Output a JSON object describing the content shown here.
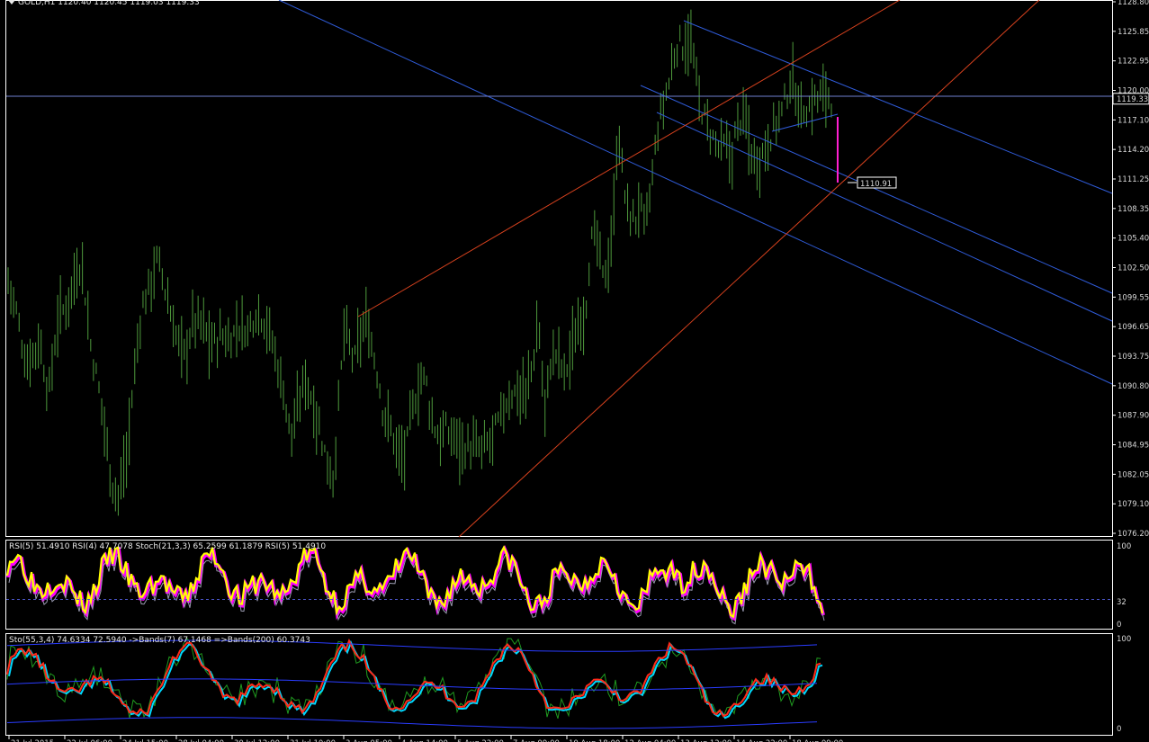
{
  "colors": {
    "background": "#000000",
    "frame": "#ffffff",
    "bar": "#4e9a3c",
    "channel_blue": "#2f5bd8",
    "channel_red": "#d9421e",
    "magenta": "#ff1fd0",
    "rsi_main": "#ffff00",
    "rsi_glow": "#ff00ff",
    "sto_red": "#ff2a1a",
    "sto_cyan": "#00d8ff",
    "sto_green": "#1f9a1f",
    "bands_blue": "#2a3cff"
  },
  "main": {
    "header": "GOLD,H1  1120.40 1120.45 1119.03 1119.33",
    "price_axis": [
      "1128.80",
      "1125.85",
      "1122.95",
      "1120.00",
      "1117.10",
      "1114.20",
      "1111.25",
      "1108.35",
      "1105.40",
      "1102.50",
      "1099.55",
      "1096.65",
      "1093.75",
      "1090.80",
      "1087.90",
      "1084.95",
      "1082.05",
      "1079.10",
      "1076.20"
    ],
    "current_price": "1119.33",
    "target_label": "1110.91"
  },
  "rsi_pane": {
    "header": "RSI(5) 51.4910  RSI(4) 47.7078  Stoch(21,3,3) 65.2599 61.1879  RSI(5) 51.4910",
    "levels": [
      "100",
      "32",
      "0"
    ]
  },
  "sto_pane": {
    "header": "Sto(55,3,4) 74.6334 72.5940  ->Bands(7) 67.1468  =>Bands(200) 60.3743",
    "levels": [
      "100",
      "0"
    ]
  },
  "chart_data": [
    {
      "type": "ohlc",
      "title": "GOLD,H1",
      "ohlc_last": {
        "open": 1120.4,
        "high": 1120.45,
        "low": 1119.03,
        "close": 1119.33
      },
      "ylim": [
        1076.2,
        1128.8
      ],
      "x_count": 300,
      "close_path": [
        [
          0,
          1101.5
        ],
        [
          10,
          1098.0
        ],
        [
          20,
          1093.0
        ],
        [
          35,
          1095.5
        ],
        [
          45,
          1090.0
        ],
        [
          55,
          1097.5
        ],
        [
          65,
          1099.0
        ],
        [
          75,
          1102.0
        ],
        [
          82,
          1103.5
        ],
        [
          90,
          1096.0
        ],
        [
          98,
          1092.0
        ],
        [
          106,
          1088.0
        ],
        [
          114,
          1082.0
        ],
        [
          122,
          1080.0
        ],
        [
          132,
          1084.0
        ],
        [
          140,
          1092.0
        ],
        [
          148,
          1098.5
        ],
        [
          156,
          1100.5
        ],
        [
          166,
          1103.5
        ],
        [
          176,
          1100.0
        ],
        [
          186,
          1096.0
        ],
        [
          196,
          1094.0
        ],
        [
          206,
          1097.5
        ],
        [
          216,
          1097.0
        ],
        [
          226,
          1095.0
        ],
        [
          236,
          1096.0
        ],
        [
          246,
          1095.5
        ],
        [
          256,
          1097.0
        ],
        [
          266,
          1096.5
        ],
        [
          276,
          1098.5
        ],
        [
          286,
          1097.5
        ],
        [
          296,
          1094.5
        ],
        [
          306,
          1090.5
        ],
        [
          314,
          1086.0
        ],
        [
          322,
          1088.5
        ],
        [
          330,
          1092.0
        ],
        [
          340,
          1089.0
        ],
        [
          348,
          1086.0
        ],
        [
          356,
          1083.0
        ],
        [
          362,
          1082.0
        ],
        [
          368,
          1090.0
        ],
        [
          374,
          1097.0
        ],
        [
          380,
          1094.5
        ],
        [
          386,
          1093.5
        ],
        [
          392,
          1096.0
        ],
        [
          398,
          1097.5
        ],
        [
          404,
          1095.0
        ],
        [
          410,
          1092.5
        ],
        [
          416,
          1089.0
        ],
        [
          424,
          1087.0
        ],
        [
          432,
          1085.0
        ],
        [
          440,
          1083.5
        ],
        [
          448,
          1088.0
        ],
        [
          456,
          1091.0
        ],
        [
          464,
          1092.0
        ],
        [
          470,
          1088.0
        ],
        [
          478,
          1086.0
        ],
        [
          486,
          1086.5
        ],
        [
          496,
          1086.0
        ],
        [
          506,
          1085.0
        ],
        [
          516,
          1085.0
        ],
        [
          526,
          1084.5
        ],
        [
          536,
          1085.5
        ],
        [
          546,
          1087.5
        ],
        [
          556,
          1090.0
        ],
        [
          566,
          1090.5
        ],
        [
          576,
          1090.0
        ],
        [
          584,
          1094.0
        ],
        [
          590,
          1097.0
        ],
        [
          596,
          1088.0
        ],
        [
          602,
          1093.0
        ],
        [
          610,
          1094.5
        ],
        [
          618,
          1092.0
        ],
        [
          626,
          1094.5
        ],
        [
          634,
          1097.0
        ],
        [
          642,
          1099.0
        ],
        [
          648,
          1105.0
        ],
        [
          654,
          1106.0
        ],
        [
          660,
          1101.5
        ],
        [
          666,
          1103.0
        ],
        [
          672,
          1106.0
        ],
        [
          678,
          1117.0
        ],
        [
          684,
          1110.5
        ],
        [
          690,
          1108.0
        ],
        [
          696,
          1107.0
        ],
        [
          702,
          1109.0
        ],
        [
          708,
          1106.5
        ],
        [
          714,
          1110.0
        ],
        [
          720,
          1115.0
        ],
        [
          726,
          1118.0
        ],
        [
          732,
          1120.0
        ],
        [
          738,
          1122.5
        ],
        [
          744,
          1125.0
        ],
        [
          750,
          1124.5
        ],
        [
          756,
          1125.5
        ],
        [
          762,
          1123.0
        ],
        [
          768,
          1119.0
        ],
        [
          774,
          1117.5
        ],
        [
          780,
          1116.0
        ],
        [
          788,
          1114.5
        ],
        [
          796,
          1114.5
        ],
        [
          804,
          1113.5
        ],
        [
          812,
          1117.5
        ],
        [
          820,
          1117.0
        ],
        [
          826,
          1114.0
        ],
        [
          832,
          1113.0
        ],
        [
          838,
          1114.0
        ],
        [
          846,
          1115.5
        ],
        [
          854,
          1117.0
        ],
        [
          862,
          1118.5
        ],
        [
          870,
          1121.5
        ],
        [
          878,
          1119.0
        ],
        [
          886,
          1118.0
        ],
        [
          894,
          1119.0
        ],
        [
          902,
          1119.5
        ],
        [
          910,
          1120.0
        ],
        [
          915,
          1119.33
        ]
      ],
      "current_price": 1119.33,
      "horizontal_line": 1119.33,
      "target_price": 1110.91
    },
    {
      "type": "line",
      "title": "RSI(5) / RSI(4) / Stoch(21,3,3)",
      "ylim": [
        0,
        100
      ],
      "level": 32,
      "series": [
        {
          "name": "RSI(5)",
          "last": 51.491
        },
        {
          "name": "RSI(4)",
          "last": 47.7078
        },
        {
          "name": "Stoch(21,3,3)",
          "last": [
            65.2599,
            61.1879
          ]
        }
      ]
    },
    {
      "type": "line",
      "title": "Sto(55,3,4)",
      "ylim": [
        0,
        100
      ],
      "series": [
        {
          "name": "Sto(55,3,4)",
          "last": [
            74.6334,
            72.594
          ]
        },
        {
          "name": "->Bands(7)",
          "last": 67.1468
        },
        {
          "name": "=>Bands(200)",
          "last": 60.3743
        }
      ]
    }
  ],
  "time_axis": [
    "21 Jul 2015",
    "22 Jul 06:00",
    "24 Jul 15:00",
    "28 Jul 04:00",
    "30 Jul 12:00",
    "31 Jul 10:00",
    "3 Aug 05:00",
    "4 Aug 14:00",
    "5 Aug 22:00",
    "7 Aug 09:00",
    "10 Aug 18:00",
    "12 Aug 04:00",
    "13 Aug 12:00",
    "14 Aug 22:00",
    "18 Aug 09:00"
  ]
}
